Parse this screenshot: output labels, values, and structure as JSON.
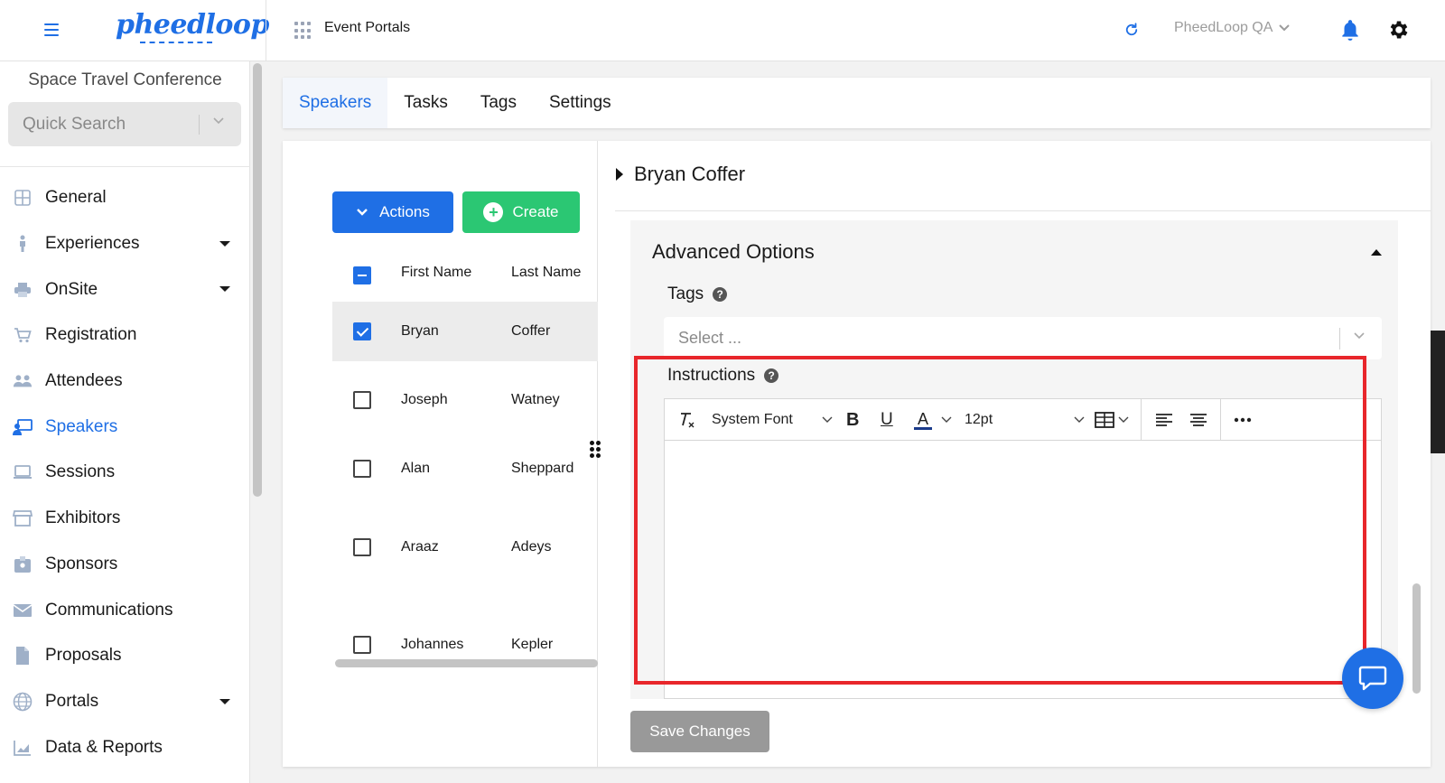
{
  "header": {
    "logo_text": "pheedloop",
    "section_title": "Event Portals",
    "org_name": "PheedLoop QA"
  },
  "sidebar": {
    "event_name": "Space Travel Conference",
    "search_placeholder": "Quick Search",
    "items": [
      {
        "label": "General",
        "icon": "grid-icon",
        "has_caret": false
      },
      {
        "label": "Experiences",
        "icon": "person-icon",
        "has_caret": true
      },
      {
        "label": "OnSite",
        "icon": "printer-icon",
        "has_caret": true
      },
      {
        "label": "Registration",
        "icon": "cart-icon",
        "has_caret": false
      },
      {
        "label": "Attendees",
        "icon": "people-icon",
        "has_caret": false
      },
      {
        "label": "Speakers",
        "icon": "presenter-icon",
        "has_caret": false,
        "active": true
      },
      {
        "label": "Sessions",
        "icon": "laptop-icon",
        "has_caret": false
      },
      {
        "label": "Exhibitors",
        "icon": "store-icon",
        "has_caret": false
      },
      {
        "label": "Sponsors",
        "icon": "badge-icon",
        "has_caret": false
      },
      {
        "label": "Communications",
        "icon": "mail-icon",
        "has_caret": false
      },
      {
        "label": "Proposals",
        "icon": "document-icon",
        "has_caret": false
      },
      {
        "label": "Portals",
        "icon": "globe-icon",
        "has_caret": true
      },
      {
        "label": "Data & Reports",
        "icon": "chart-icon",
        "has_caret": false
      }
    ]
  },
  "tabs": [
    {
      "label": "Speakers",
      "active": true
    },
    {
      "label": "Tasks",
      "active": false
    },
    {
      "label": "Tags",
      "active": false
    },
    {
      "label": "Settings",
      "active": false
    }
  ],
  "actions": {
    "actions_label": "Actions",
    "create_label": "Create"
  },
  "table": {
    "columns": [
      "First Name",
      "Last Name"
    ],
    "rows": [
      {
        "first": "Bryan",
        "last": "Coffer",
        "checked": true
      },
      {
        "first": "Joseph",
        "last": "Watney",
        "checked": false
      },
      {
        "first": "Alan",
        "last": "Sheppard",
        "checked": false
      },
      {
        "first": "Araaz",
        "last": "Adeys",
        "checked": false
      },
      {
        "first": "Johannes",
        "last": "Kepler",
        "checked": false
      }
    ]
  },
  "detail": {
    "speaker_name": "Bryan Coffer",
    "advanced_title": "Advanced Options",
    "tags_label": "Tags",
    "tags_placeholder": "Select ...",
    "instructions_label": "Instructions",
    "editor": {
      "font": "System Font",
      "size": "12pt"
    },
    "save_label": "Save Changes"
  },
  "colors": {
    "primary": "#1f6fe5",
    "success": "#2bc773",
    "highlight": "#e8262b"
  }
}
